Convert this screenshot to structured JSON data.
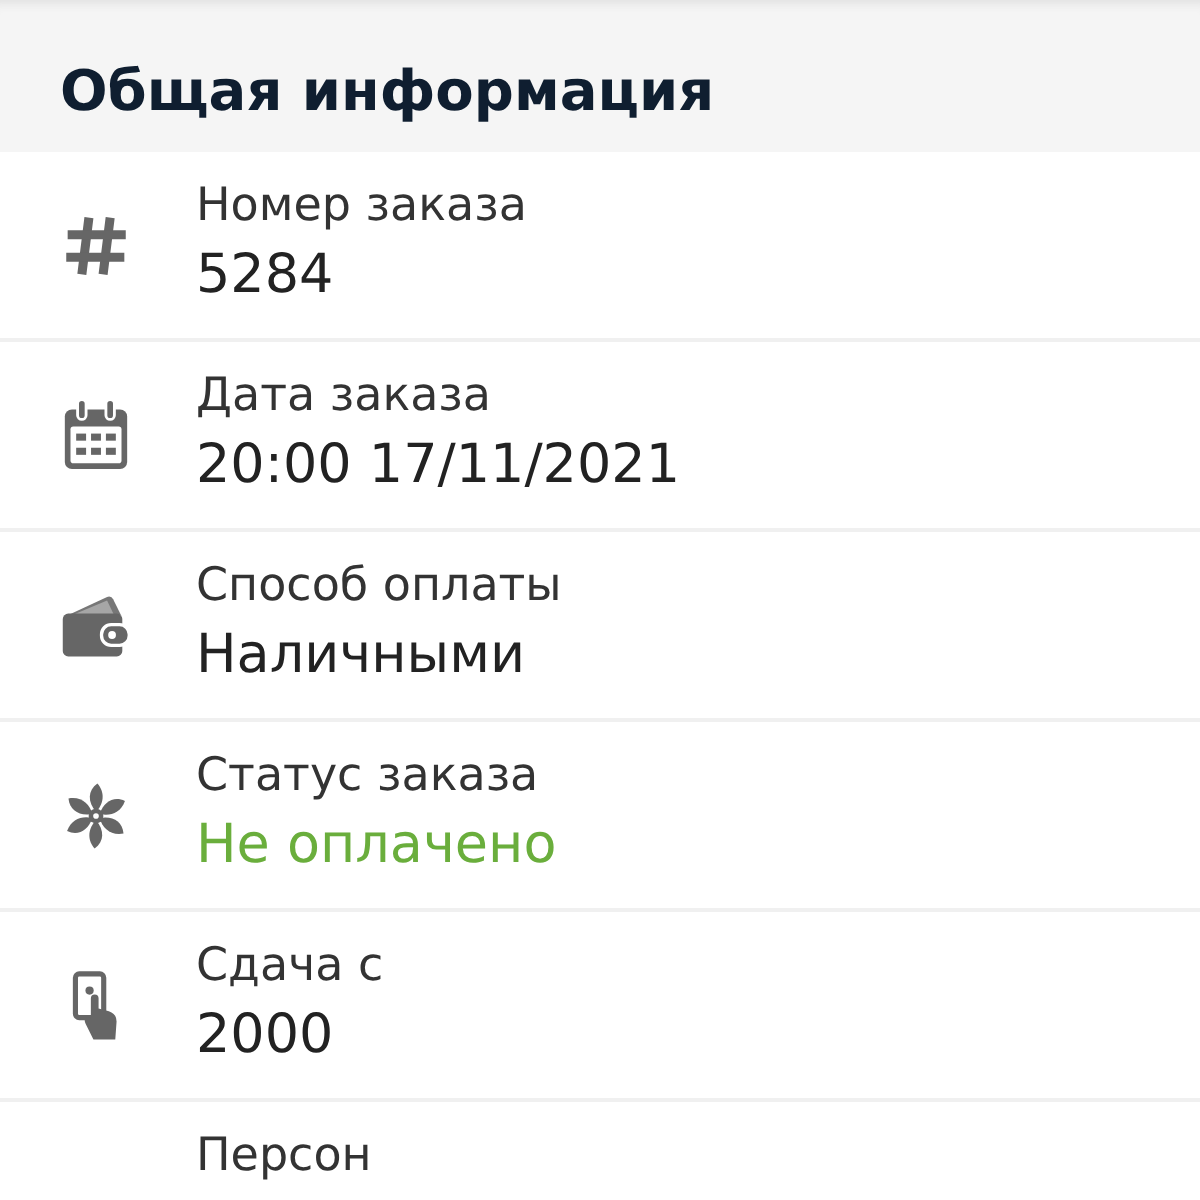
{
  "section": {
    "title": "Общая информация"
  },
  "fields": [
    {
      "kind": "hash",
      "label": "Номер заказа",
      "value": "5284"
    },
    {
      "kind": "calendar",
      "label": "Дата заказа",
      "value": "20:00 17/11/2021"
    },
    {
      "kind": "wallet",
      "label": "Способ оплаты",
      "value": "Наличными"
    },
    {
      "kind": "flower",
      "label": "Статус заказа",
      "value": "Не оплачено",
      "color": "#6aae3c"
    },
    {
      "kind": "cash",
      "label": "Сдача с",
      "value": "2000"
    },
    {
      "label": "Персон"
    }
  ]
}
